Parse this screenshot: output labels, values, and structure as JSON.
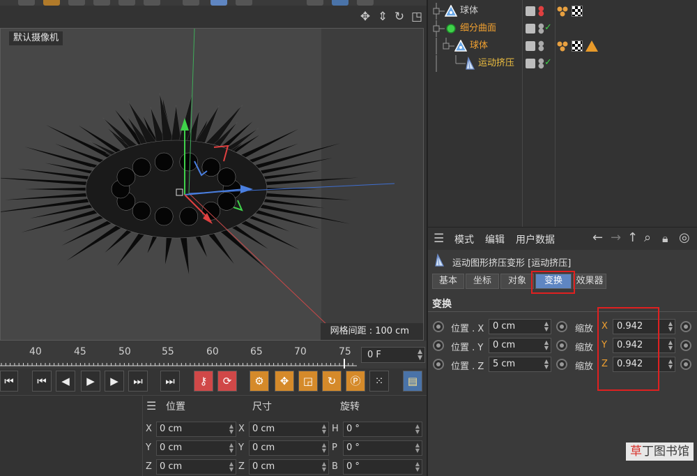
{
  "viewport": {
    "camera_label": "默认摄像机",
    "grid_spacing": "网格间距 : 100 cm"
  },
  "timeline": {
    "ticks": [
      "40",
      "45",
      "50",
      "55",
      "60",
      "65",
      "70",
      "75"
    ],
    "current_frame": "0 F"
  },
  "coordinates": {
    "headers": {
      "position": "位置",
      "size": "尺寸",
      "rotation": "旋转"
    },
    "rows": [
      {
        "axis": "X",
        "pos": "0 cm",
        "size_axis": "X",
        "size": "0 cm",
        "rot_axis": "H",
        "rot": "0 °"
      },
      {
        "axis": "Y",
        "pos": "0 cm",
        "size_axis": "Y",
        "size": "0 cm",
        "rot_axis": "P",
        "rot": "0 °"
      },
      {
        "axis": "Z",
        "pos": "0 cm",
        "size_axis": "Z",
        "size": "0 cm",
        "rot_axis": "B",
        "rot": "0 °"
      }
    ]
  },
  "objects": [
    {
      "name": "球体",
      "color": "#e8e8e8"
    },
    {
      "name": "细分曲面",
      "color": "#f0a030"
    },
    {
      "name": "球体",
      "color": "#f0a030"
    },
    {
      "name": "运动挤压",
      "color": "#f0c040"
    }
  ],
  "attributes": {
    "menu": [
      "模式",
      "编辑",
      "用户数据"
    ],
    "object_title": "运动图形挤压变形 [运动挤压]",
    "tabs": [
      "基本",
      "坐标",
      "对象",
      "变换",
      "效果器"
    ],
    "active_tab": "变换",
    "section": "变换",
    "position_label": "位置",
    "scale_label": "缩放",
    "rows": [
      {
        "axis": "X",
        "position": "0 cm",
        "scale": "0.942"
      },
      {
        "axis": "Y",
        "position": "0 cm",
        "scale": "0.942"
      },
      {
        "axis": "Z",
        "position": "5 cm",
        "scale": "0.942"
      }
    ]
  },
  "watermark": {
    "a": "草",
    "b": "丁",
    "c": "图书馆"
  },
  "colors": {
    "accent_blue": "#5f86c2",
    "highlight_red": "#e02020",
    "object_orange": "#f0a030"
  }
}
